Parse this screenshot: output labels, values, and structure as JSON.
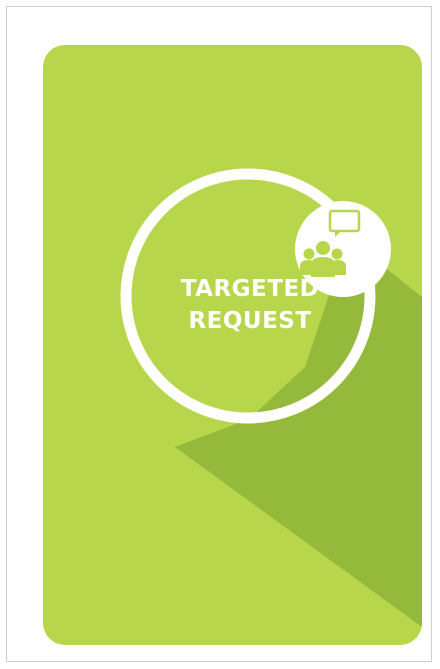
{
  "card": {
    "title_line1": "TARGETED",
    "title_line2": "REQUEST",
    "badge_icon": "group-discussion-icon"
  },
  "colors": {
    "background": "#b7d64b",
    "shadow": "#95b93a",
    "ring": "#ffffff",
    "icon": "#b7d64b"
  }
}
